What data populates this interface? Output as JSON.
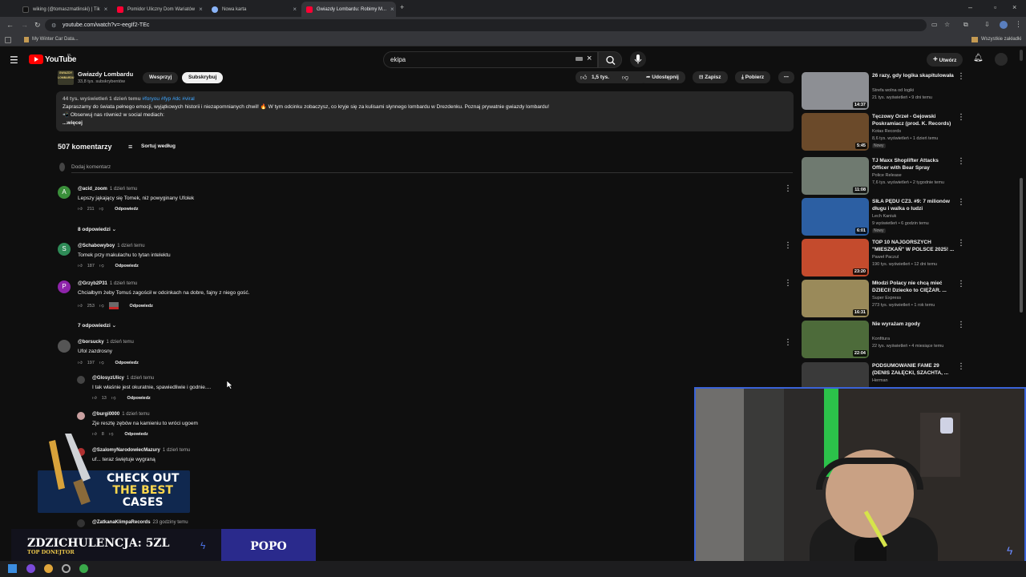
{
  "browser": {
    "tabs": [
      {
        "label": "wiking (@tomaszmatlinski) | Tik",
        "color": "#111111"
      },
      {
        "label": "Pomidor Uliczny Dom Wariatów",
        "color": "#ff0033"
      },
      {
        "label": "Nowa karta",
        "color": "#8ab4f8"
      },
      {
        "label": "Gwiazdy Lombardu: Robimy M...",
        "color": "#ff0033"
      }
    ],
    "url": "youtube.com/watch?v=-eegIf2-TEc",
    "bookmark": "My Winter Car Data...",
    "all_bookmarks": "Wszystkie zakładki"
  },
  "youtube": {
    "logo_text": "YouTube",
    "logo_sup": "PL",
    "search_query": "ekipa",
    "create_label": "Utwórz"
  },
  "channel": {
    "logo_text": "GWIAZDY LOMBARDU",
    "name": "Gwiazdy Lombardu",
    "subscribers": "33,8 tys. subskrybentów",
    "support_label": "Wesprzyj",
    "subscribe_label": "Subskrybuj"
  },
  "actions": {
    "likes": "1,5 tys.",
    "share": "Udostępnij",
    "save": "Zapisz",
    "download": "Pobierz"
  },
  "description": {
    "stats": "44 tys. wyświetleń  1 dzień temu",
    "tags": "#foryou #fyp #dc #viral",
    "line1": "Zapraszamy do świata pełnego emocji, wyjątkowych historii i niezapomnianych chwil! 🔥 W tym odcinku zobaczysz, co kryje się za kulisami słynnego lombardu w Drezdenku. Poznaj prywatnie gwiazdy lombardu!",
    "line2": "📲 Obserwuj nas również w social mediach:",
    "more": "...więcej"
  },
  "comments_section": {
    "count": "507 komentarzy",
    "sort_label": "Sortuj według",
    "add_placeholder": "Dodaj komentarz",
    "reply_label": "Odpowiedz",
    "comments": [
      {
        "author": "@acid_zoom",
        "time": "1 dzień temu",
        "text": "Lepszy jąkający się Tomek, niż powyginany Ufolek",
        "likes": "211",
        "avatar_letter": "A",
        "avatar_color": "#3a8f3a",
        "replies": "8 odpowiedzi"
      },
      {
        "author": "@Schabowyboy",
        "time": "1 dzień temu",
        "text": "Tomek przy makulachu to tytan intelektu",
        "likes": "187",
        "avatar_letter": "S",
        "avatar_color": "#2e8b57",
        "replies": ""
      },
      {
        "author": "@Grzyb2P31",
        "time": "1 dzień temu",
        "text": "Chciałbym żeby Tomuś zagościł w odcinkach na dobre, fajny z niego gość.",
        "likes": "253",
        "avatar_letter": "P",
        "avatar_color": "#8e24aa",
        "replies": "7 odpowiedzi"
      },
      {
        "author": "@borsucky",
        "time": "1 dzień temu",
        "text": "Ufol zazdrosny",
        "likes": "197",
        "avatar_letter": "",
        "avatar_color": "#555555",
        "replies": ""
      }
    ],
    "nested": [
      {
        "author": "@GlosyzUlicy",
        "time": "1 dzień temu",
        "text": "I tak właśnie jest okuratnie, spawiedliwie i godnie....",
        "likes": "13"
      },
      {
        "author": "@burgi0000",
        "time": "1 dzień temu",
        "text": "Zje resztę zębów na kamieniu to wróci ugoem",
        "likes": "8"
      },
      {
        "author": "@SzalomyNarodowiecMazury",
        "time": "1 dzień temu",
        "text": "uf... teraz świętuje wygraną",
        "likes": ""
      },
      {
        "author": "@ZatkanaKlimpaRecords",
        "time": "23 godziny temu",
        "text": "",
        "likes": ""
      }
    ]
  },
  "sidebar": {
    "videos": [
      {
        "title": "26 razy, gdy logika skapitulowała",
        "channel": "Strefa wolna od logiki",
        "meta": "21 tys. wyświetleń • 9 dni temu",
        "duration": "14:37",
        "thumb": "#8d8f94",
        "badge": ""
      },
      {
        "title": "Tęczowy Orzeł - Gejowski Poskramiacz (prod. K. Records)",
        "channel": "Kotas Records",
        "meta": "8,6 tys. wyświetleń • 1 dzień temu",
        "duration": "5:45",
        "thumb": "#6b4a2a",
        "badge": "Nowy"
      },
      {
        "title": "TJ Maxx Shoplifter Attacks Officer with Bear Spray",
        "channel": "Police Release",
        "meta": "7,6 tys. wyświetleń • 2 tygodnie temu",
        "duration": "11:08",
        "thumb": "#6f7a70",
        "badge": ""
      },
      {
        "title": "SIŁA PĘDU CZ3. #9: 7 milionów długu i walka o ludzi",
        "channel": "Lech Kaniuk",
        "meta": "9 wyświetleń • 6 godzin temu",
        "duration": "6:01",
        "thumb": "#2c5fa3",
        "badge": "Nowy"
      },
      {
        "title": "TOP 10 NAJGORSZYCH \"MIESZKAŃ\" W POLSCE 2025! ...",
        "channel": "Paweł Paczul",
        "meta": "190 tys. wyświetleń • 12 dni temu",
        "duration": "23:20",
        "thumb": "#c44b2d",
        "badge": ""
      },
      {
        "title": "Młodzi Polacy nie chcą mieć DZIECI! Dziecko to CIĘŻAR. ...",
        "channel": "Super Express",
        "meta": "273 tys. wyświetleń • 1 rok temu",
        "duration": "16:31",
        "thumb": "#9a8a5a",
        "badge": ""
      },
      {
        "title": "Nie wyrażam zgody",
        "channel": "Konfitura",
        "meta": "22 tys. wyświetleń • 4 miesiące temu",
        "duration": "22:04",
        "thumb": "#4d6b3a",
        "badge": ""
      },
      {
        "title": "PODSUMOWANIE FAME 29 (DENIS ZAŁĘCKI, SZACHTA, ...",
        "channel": "Herman",
        "meta": "",
        "duration": "",
        "thumb": "#3a3a3a",
        "badge": ""
      }
    ]
  },
  "overlay": {
    "ad_line1": "CHECK OUT",
    "ad_line2": "THE BEST",
    "ad_line3": "CASES",
    "banner_main": "ZDZICHULENCJA: 5ZL",
    "banner_sub": "TOP DONEJTOR",
    "banner_right": "POPO"
  }
}
